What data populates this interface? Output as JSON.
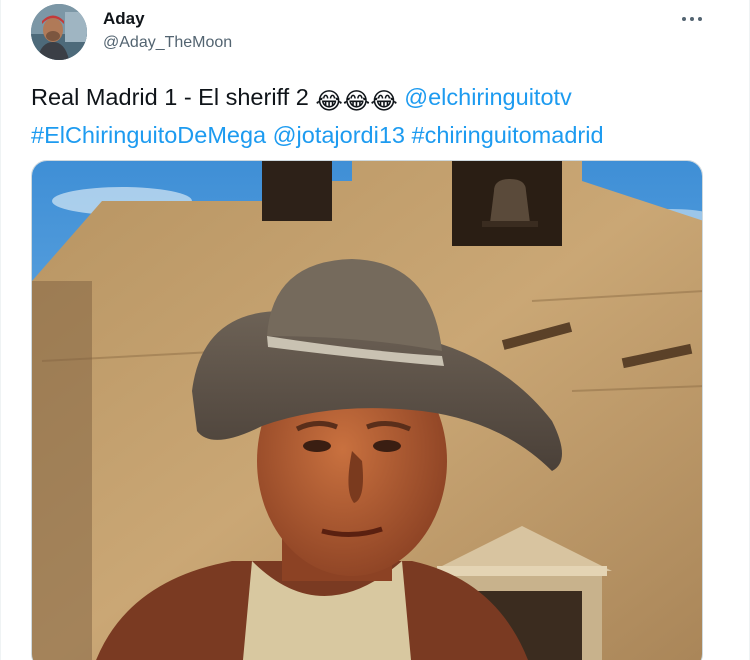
{
  "author": {
    "name": "Aday",
    "handle": "@Aday_TheMoon",
    "avatar_icon": "user-avatar-photo"
  },
  "more_icon": "more-options-icon",
  "tweet": {
    "text_prefix": "Real Madrid 1 - El sheriff 2",
    "emoji": [
      "😂",
      "😂",
      "😂"
    ],
    "mention_1": "@elchiringuitotv",
    "hashtag_1": "#ElChiringuitoDeMega",
    "mention_2": "@jotajordi13",
    "hashtag_2": "#chiringuitomadrid"
  },
  "media": {
    "type": "photo"
  },
  "colors": {
    "link": "#1d9bf0",
    "text": "#0f1419",
    "secondary": "#536471"
  }
}
